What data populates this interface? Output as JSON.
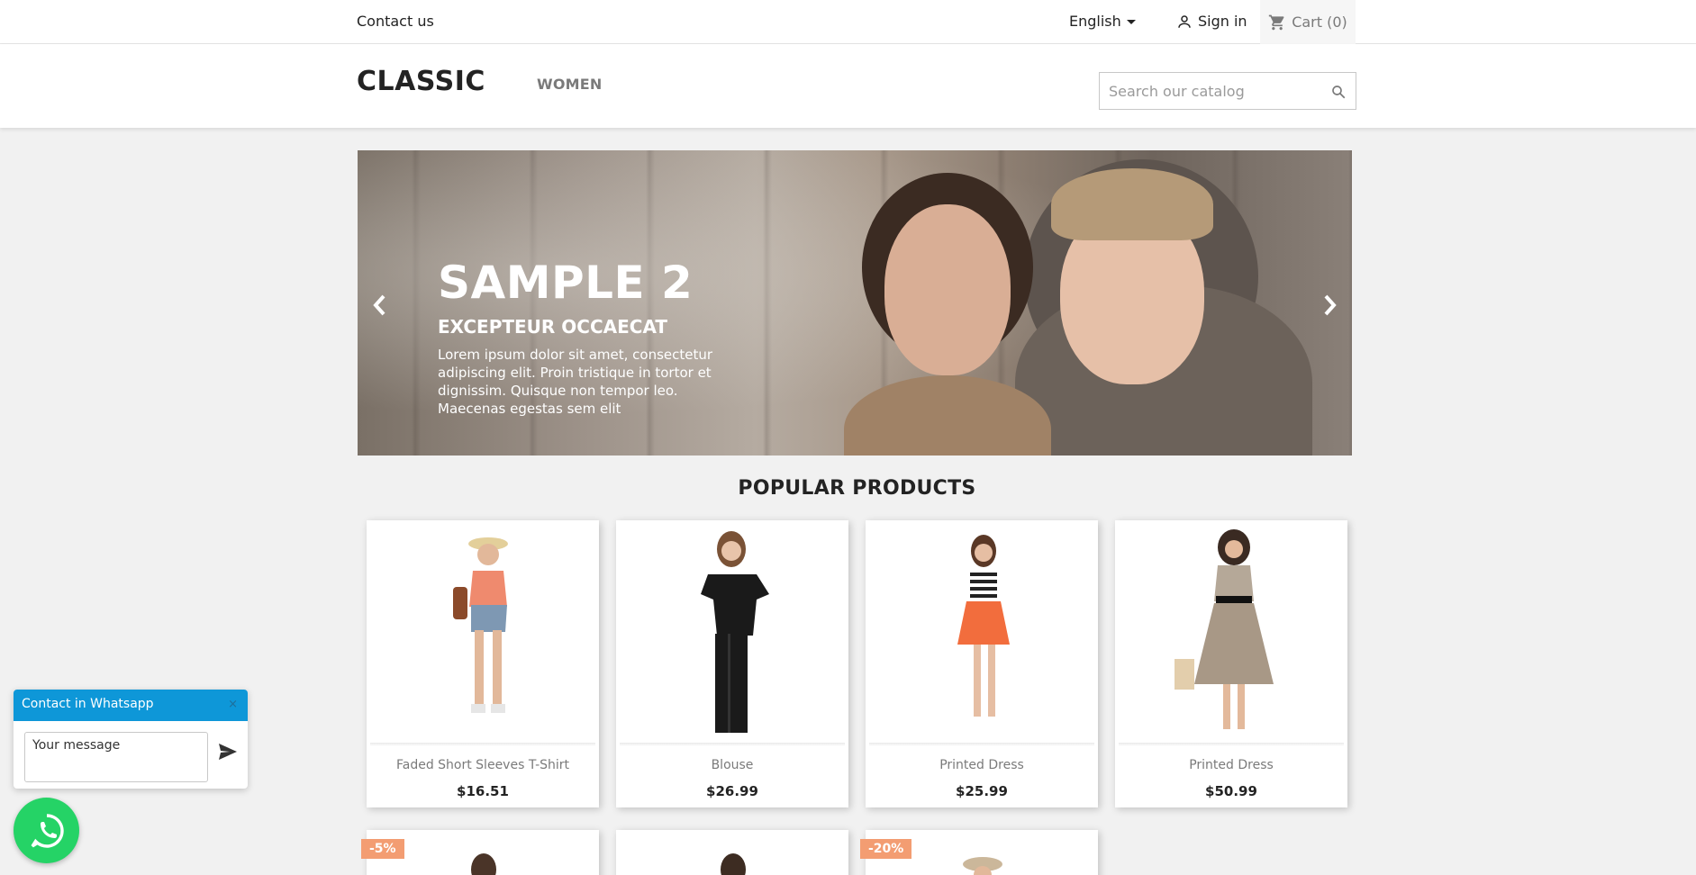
{
  "topnav": {
    "contact_label": "Contact us",
    "language": "English",
    "signin_label": "Sign in",
    "cart_label": "Cart (0)"
  },
  "header": {
    "logo": "CLASSIC",
    "menu_women": "WOMEN",
    "search_placeholder": "Search our catalog"
  },
  "slider": {
    "title": "SAMPLE 2",
    "subtitle": "EXCEPTEUR OCCAECAT",
    "text": "Lorem ipsum dolor sit amet, consectetur adipiscing elit. Proin tristique in tortor et dignissim. Quisque non tempor leo. Maecenas egestas sem elit"
  },
  "popular": {
    "title": "POPULAR PRODUCTS",
    "products": [
      {
        "name": "Faded Short Sleeves T-Shirt",
        "price": "$16.51"
      },
      {
        "name": "Blouse",
        "price": "$26.99"
      },
      {
        "name": "Printed Dress",
        "price": "$25.99"
      },
      {
        "name": "Printed Dress",
        "price": "$50.99"
      }
    ],
    "row2_badges": [
      "-5%",
      "",
      "-20%"
    ]
  },
  "whatsapp": {
    "header": "Contact in Whatsapp",
    "close": "×",
    "placeholder": "Your message"
  },
  "icons": [
    "person-icon",
    "cart-icon",
    "search-icon",
    "chevron-left-icon",
    "chevron-right-icon",
    "send-icon",
    "whatsapp-icon"
  ],
  "colors": {
    "whatsapp_header": "#0e97d8",
    "whatsapp_button": "#25d366",
    "badge": "#f39d72"
  }
}
